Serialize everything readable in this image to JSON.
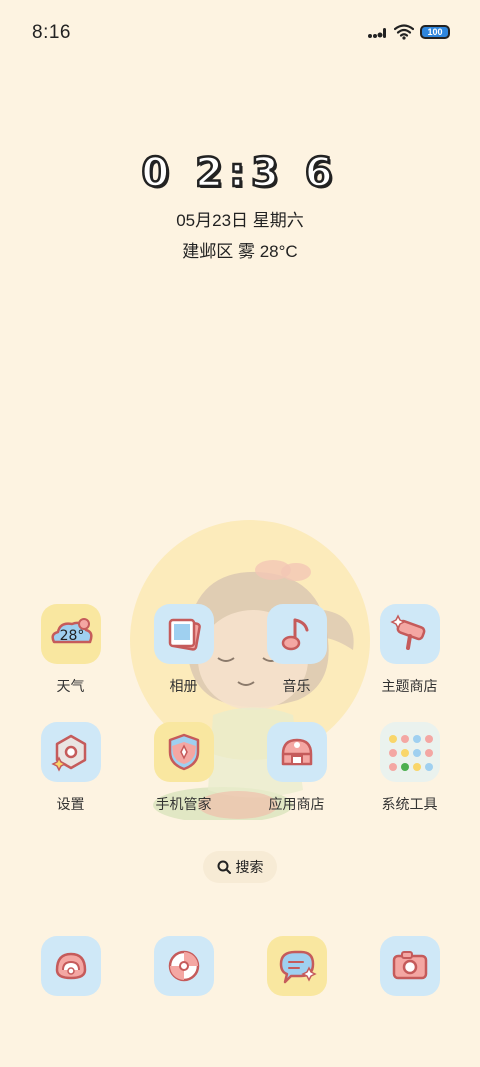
{
  "status_bar": {
    "time": "8:16",
    "battery": "100"
  },
  "clock_widget": {
    "time": "0 2:3 6",
    "date": "05月23日 星期六",
    "weather": "建邺区 雾 28°C"
  },
  "apps": [
    {
      "label": "天气",
      "icon": "weather-icon",
      "badge": "28°"
    },
    {
      "label": "相册",
      "icon": "photos-icon"
    },
    {
      "label": "音乐",
      "icon": "music-icon"
    },
    {
      "label": "主题商店",
      "icon": "theme-store-icon"
    },
    {
      "label": "设置",
      "icon": "settings-icon"
    },
    {
      "label": "手机管家",
      "icon": "security-icon"
    },
    {
      "label": "应用商店",
      "icon": "app-store-icon"
    },
    {
      "label": "系统工具",
      "icon": "system-tools-folder-icon"
    }
  ],
  "search": {
    "label": "搜索"
  },
  "dock": [
    {
      "icon": "phone-icon"
    },
    {
      "icon": "browser-icon"
    },
    {
      "icon": "messages-icon"
    },
    {
      "icon": "camera-icon"
    }
  ],
  "colors": {
    "background": "#fdf3e1",
    "icon_blue": "#cfe8f7",
    "icon_yellow": "#f9e7a0",
    "icon_pink": "#f4a7a3",
    "outline": "#c55b5b"
  }
}
